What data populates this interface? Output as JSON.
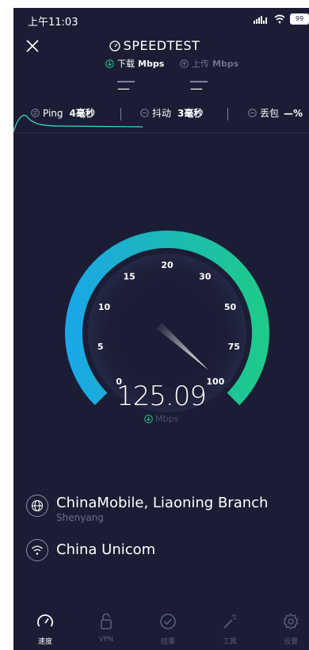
{
  "status": {
    "time": "上午11:03",
    "battery": "99"
  },
  "header": {
    "title": "SPEEDTEST",
    "download_label": "下载",
    "download_unit": "Mbps",
    "upload_label": "上传",
    "upload_unit": "Mbps",
    "download_value": "—",
    "upload_value": "—"
  },
  "stats": {
    "ping_label": "Ping",
    "ping_value": "4毫秒",
    "jitter_label": "抖动",
    "jitter_value": "3毫秒",
    "loss_label": "丢包",
    "loss_value": "—%"
  },
  "gauge": {
    "ticks": [
      "0",
      "5",
      "10",
      "15",
      "20",
      "30",
      "50",
      "75",
      "100"
    ],
    "value": "125.09",
    "unit": "Mbps",
    "colors": {
      "start": "#1aa8e6",
      "end": "#1fc98a",
      "needle": "#ffffff"
    }
  },
  "server": {
    "provider": "ChinaMobile, Liaoning Branch",
    "city": "Shenyang",
    "network": "China Unicom"
  },
  "nav": {
    "items": [
      {
        "label": "速度",
        "icon": "speedometer-icon"
      },
      {
        "label": "VPN",
        "icon": "lock-icon"
      },
      {
        "label": "结果",
        "icon": "check-circle-icon"
      },
      {
        "label": "工具",
        "icon": "magic-wand-icon"
      },
      {
        "label": "设置",
        "icon": "gear-icon"
      }
    ]
  }
}
